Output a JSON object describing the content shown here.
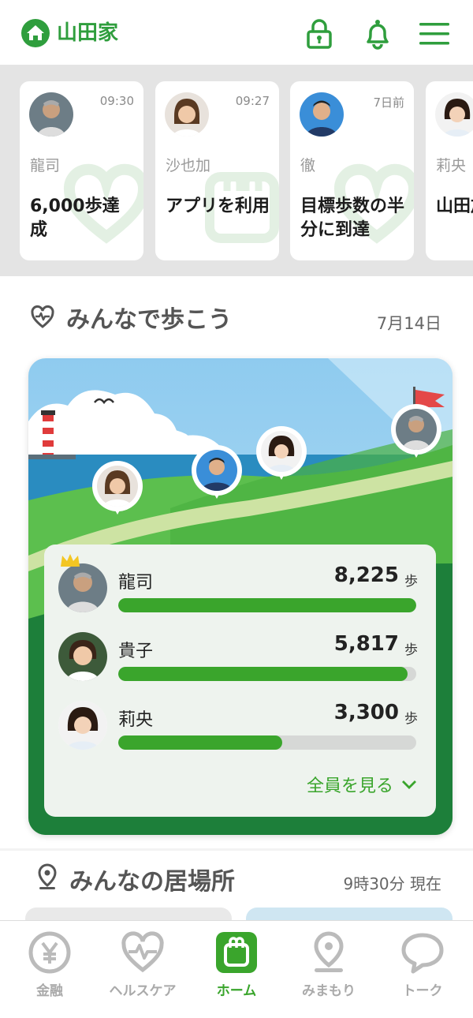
{
  "header": {
    "family_name": "山田家",
    "icons": [
      "home-icon",
      "lock-icon",
      "bell-icon",
      "menu-icon"
    ],
    "accent_color": "#2f9e3d"
  },
  "activity_cards": [
    {
      "name": "龍司",
      "time": "09:30",
      "text": "6,000歩達成"
    },
    {
      "name": "沙也加",
      "time": "09:27",
      "text": "アプリを利用"
    },
    {
      "name": "徹",
      "time": "7日前",
      "text": "目標歩数の半分に到達"
    },
    {
      "name": "莉央",
      "time": "",
      "text": "山田加"
    }
  ],
  "walk": {
    "title": "みんなで歩こう",
    "date": "7月14日",
    "ranking": [
      {
        "name": "龍司",
        "steps": "8,225",
        "unit": "歩",
        "progress": 1.0,
        "leader": true
      },
      {
        "name": "貴子",
        "steps": "5,817",
        "unit": "歩",
        "progress": 0.97,
        "leader": false
      },
      {
        "name": "莉央",
        "steps": "3,300",
        "unit": "歩",
        "progress": 0.55,
        "leader": false
      }
    ],
    "see_all": "全員を見る"
  },
  "location": {
    "title": "みんなの居場所",
    "time": "9時30分 現在"
  },
  "tabs": [
    {
      "label": "金融",
      "icon": "yen-icon",
      "active": false
    },
    {
      "label": "ヘルスケア",
      "icon": "heart-pulse-icon",
      "active": false
    },
    {
      "label": "ホーム",
      "icon": "home-app-icon",
      "active": true
    },
    {
      "label": "みまもり",
      "icon": "location-pin-icon",
      "active": false
    },
    {
      "label": "トーク",
      "icon": "chat-bubble-icon",
      "active": false
    }
  ],
  "colors": {
    "green": "#3aa52c",
    "dark_green": "#1d7f3a",
    "bar_track": "#d6d8d6"
  }
}
